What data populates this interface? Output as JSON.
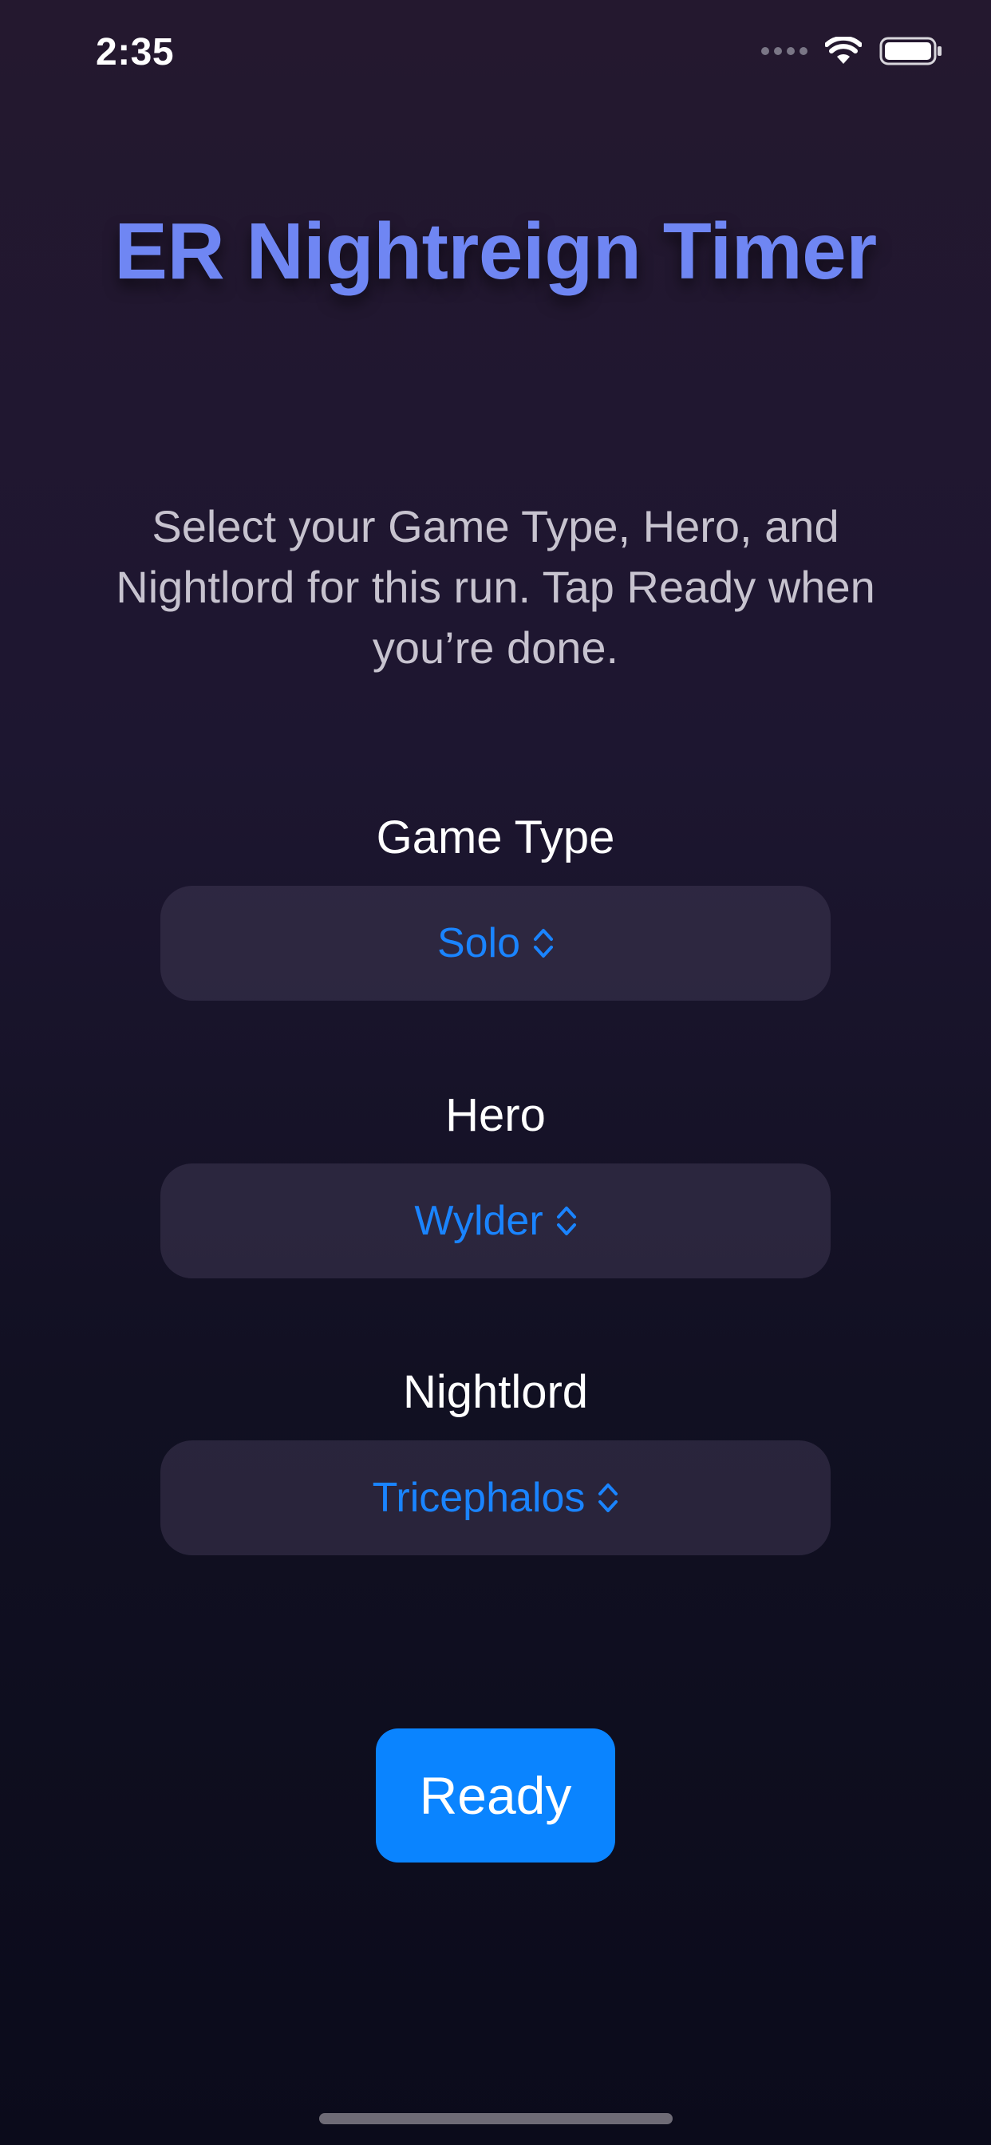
{
  "status_bar": {
    "time": "2:35",
    "icons": [
      "signal-dots-icon",
      "wifi-icon",
      "battery-icon"
    ]
  },
  "title": "ER Nightreign Timer",
  "instructions": "Select your Game Type, Hero, and Nightlord for this run. Tap Ready when you’re done.",
  "fields": {
    "game_type": {
      "label": "Game Type",
      "value": "Solo"
    },
    "hero": {
      "label": "Hero",
      "value": "Wylder"
    },
    "nightlord": {
      "label": "Nightlord",
      "value": "Tricephalos"
    }
  },
  "ready_button": {
    "label": "Ready"
  },
  "colors": {
    "accent": "#0a84ff",
    "picker_text": "#1a84ff",
    "title": "#6f86f3",
    "background_top": "#24182f",
    "background_bottom": "#0b0b1b"
  }
}
